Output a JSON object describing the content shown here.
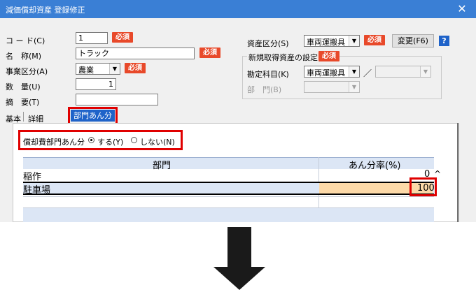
{
  "window": {
    "title": "減価償却資産 登録修正",
    "close_glyph": "✕"
  },
  "fields": {
    "code_label": "コ ー ド(C)",
    "code_value": "1",
    "name_label": "名　称(M)",
    "name_value": "トラック",
    "business_label": "事業区分(A)",
    "business_value": "農業",
    "quantity_label": "数　量(U)",
    "quantity_value": "1",
    "summary_label": "摘　要(T)",
    "summary_value": "",
    "required": "必須"
  },
  "asset": {
    "category_label": "資産区分(S)",
    "category_value": "車両運搬具",
    "change_button": "変更(F6)",
    "help_glyph": "?",
    "group_title": "新規取得資産の設定",
    "account_label": "勘定科目(K)",
    "account_value": "車両運搬具",
    "slash": "／",
    "dept_label": "部　門(B)"
  },
  "tabs": {
    "basic": "基本",
    "detail": "詳細",
    "dept_alloc": "部門あん分"
  },
  "alloc": {
    "question": "償却費部門あん分",
    "opt_yes": "する(Y)",
    "opt_no": "しない(N)",
    "col_dept": "部門",
    "col_rate": "あん分率(%)",
    "rows": [
      {
        "dept": "稲作",
        "rate": "0"
      },
      {
        "dept": "駐車場",
        "rate": "100"
      }
    ],
    "scroll_up": "^"
  },
  "colors": {
    "title": "#3a7fd5",
    "required": "#e8492a",
    "highlight": "#e00000",
    "rate_cell": "#fcd9a8"
  }
}
